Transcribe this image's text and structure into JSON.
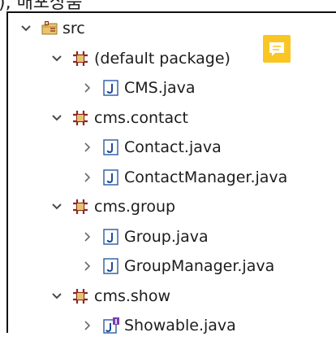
{
  "top_fragment": "), 배포상품",
  "tree": {
    "items": [
      {
        "label": "src",
        "type": "source-folder",
        "level": 0,
        "expanded": true
      },
      {
        "label": "(default package)",
        "type": "package",
        "level": 1,
        "expanded": true
      },
      {
        "label": "CMS.java",
        "type": "java-class",
        "level": 2,
        "expanded": false
      },
      {
        "label": "cms.contact",
        "type": "package",
        "level": 1,
        "expanded": true
      },
      {
        "label": "Contact.java",
        "type": "java-class",
        "level": 2,
        "expanded": false
      },
      {
        "label": "ContactManager.java",
        "type": "java-class",
        "level": 2,
        "expanded": false
      },
      {
        "label": "cms.group",
        "type": "package",
        "level": 1,
        "expanded": true
      },
      {
        "label": "Group.java",
        "type": "java-class",
        "level": 2,
        "expanded": false
      },
      {
        "label": "GroupManager.java",
        "type": "java-class",
        "level": 2,
        "expanded": false
      },
      {
        "label": "cms.show",
        "type": "package",
        "level": 1,
        "expanded": true
      },
      {
        "label": "Showable.java",
        "type": "java-interface",
        "level": 2,
        "expanded": false
      }
    ]
  },
  "colors": {
    "package_icon": "#8b2a1e",
    "file_icon_border": "#2a5aa3",
    "file_letter": "#1f4e97",
    "note": "#f9c624",
    "twisty": "#4a4a4a"
  },
  "icons": {
    "expanded": "chevron-down-icon",
    "collapsed": "chevron-right-icon",
    "source_folder": "source-folder-icon",
    "package": "package-icon",
    "java_class": "java-file-icon",
    "java_interface": "java-interface-icon",
    "comment": "comment-note-icon"
  }
}
